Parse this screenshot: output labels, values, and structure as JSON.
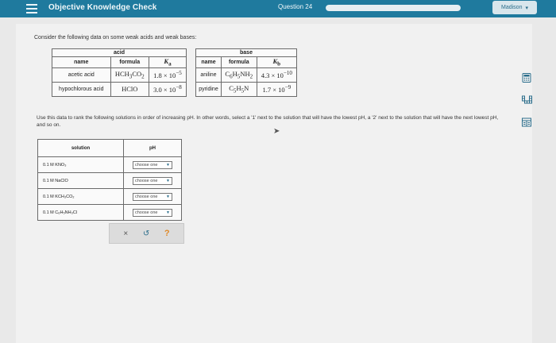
{
  "header": {
    "app_title": "Objective Knowledge Check",
    "question_label": "Question 24",
    "progress": 1.0,
    "user": "Madison"
  },
  "prompt": "Consider the following data on some weak acids and weak bases:",
  "acid_table": {
    "title": "acid",
    "col_name": "name",
    "col_formula": "formula",
    "col_k": "K",
    "col_k_sub": "a",
    "rows": [
      {
        "name": "acetic acid",
        "formula_main": "HCH",
        "formula_sub1": "3",
        "formula_mid": "CO",
        "formula_sub2": "2",
        "k_mant": "1.8 × 10",
        "k_exp": "−5"
      },
      {
        "name": "hypochlorous acid",
        "formula_main": "HClO",
        "formula_sub1": "",
        "formula_mid": "",
        "formula_sub2": "",
        "k_mant": "3.0 × 10",
        "k_exp": "−8"
      }
    ]
  },
  "base_table": {
    "title": "base",
    "col_name": "name",
    "col_formula": "formula",
    "col_k": "K",
    "col_k_sub": "b",
    "rows": [
      {
        "name": "aniline",
        "f1": "C",
        "s1": "6",
        "f2": "H",
        "s2": "5",
        "f3": "NH",
        "s3": "2",
        "k_mant": "4.3 × 10",
        "k_exp": "−10"
      },
      {
        "name": "pyridine",
        "f1": "C",
        "s1": "5",
        "f2": "H",
        "s2": "5",
        "f3": "N",
        "s3": "",
        "k_mant": "1.7 × 10",
        "k_exp": "−9"
      }
    ]
  },
  "instructions": "Use this data to rank the following solutions in order of increasing pH. In other words, select a '1' next to the solution that will have the lowest pH, a '2' next to the solution that will have the next lowest pH, and so on.",
  "solutions_table": {
    "col_solution": "solution",
    "col_ph": "pH",
    "rows": [
      {
        "solution": "0.1 M KNO₃",
        "choice": "choose one"
      },
      {
        "solution": "0.1 M NaClO",
        "choice": "choose one"
      },
      {
        "solution": "0.1 M KCH₃CO₂",
        "choice": "choose one"
      },
      {
        "solution": "0.1 M C₆H₅NH₃Cl",
        "choice": "choose one"
      }
    ]
  },
  "actions": {
    "clear": "×",
    "undo": "↺",
    "help": "?"
  },
  "side_tools": {
    "calculator_icon": "calculator-icon",
    "periodic_icon": "periodic-table-icon",
    "reference_icon": "reference-icon"
  },
  "colors": {
    "header_bg": "#1f7a9e",
    "accent": "#2a6d8b",
    "help": "#e08a2a"
  }
}
